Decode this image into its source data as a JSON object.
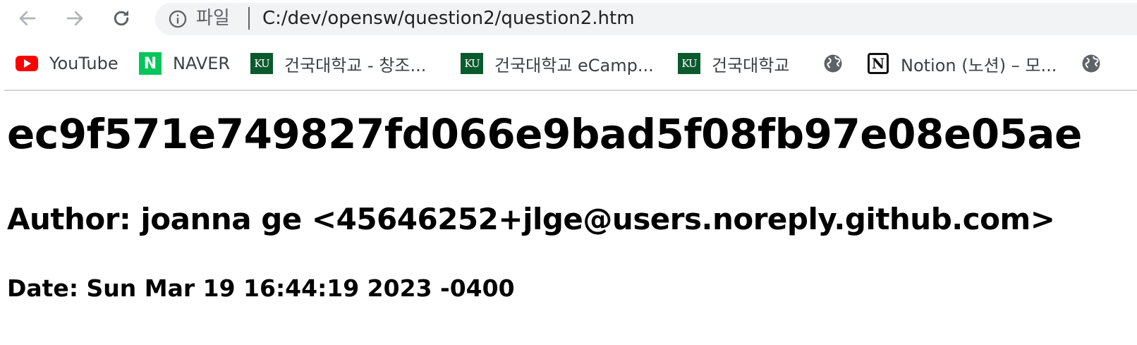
{
  "toolbar": {
    "back_icon": "arrow-left-icon",
    "forward_icon": "arrow-right-icon",
    "reload_icon": "reload-icon",
    "info_icon": "info-icon",
    "scheme_label": "파일",
    "url": "C:/dev/opensw/question2/question2.htm"
  },
  "bookmarks": [
    {
      "label": "YouTube",
      "icon": "youtube-icon"
    },
    {
      "label": "NAVER",
      "icon": "naver-icon",
      "icon_text": "N"
    },
    {
      "label": "건국대학교 - 창조...",
      "icon": "ku-icon",
      "icon_text": "KU"
    },
    {
      "label": "건국대학교 eCamp...",
      "icon": "ku-icon",
      "icon_text": "KU"
    },
    {
      "label": "건국대학교",
      "icon": "ku-icon",
      "icon_text": "KU"
    },
    {
      "label": "",
      "icon": "globe-icon"
    },
    {
      "label": "Notion (노션) – 모...",
      "icon": "notion-icon",
      "icon_text": "N"
    },
    {
      "label": "",
      "icon": "globe-icon"
    }
  ],
  "page": {
    "commit_hash": "ec9f571e749827fd066e9bad5f08fb97e08e05ae",
    "author": "Author: joanna ge <45646252+jlge@users.noreply.github.com>",
    "date": "Date: Sun Mar 19 16:44:19 2023 -0400"
  },
  "colors": {
    "omnibox_bg": "#f1f3f4",
    "icon_gray": "#5f6368",
    "youtube_red": "#ff0000",
    "naver_green": "#03c75a",
    "ku_green": "#0b5a2e"
  }
}
